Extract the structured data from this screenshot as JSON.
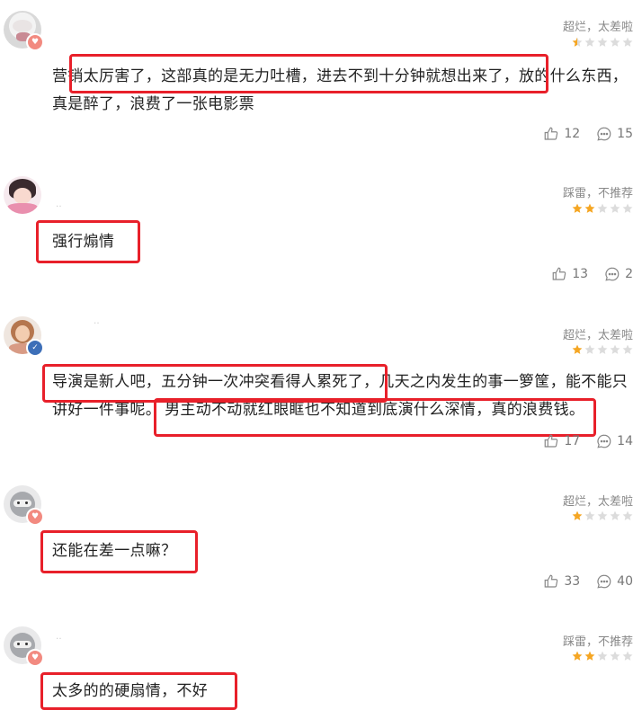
{
  "accent_red": "#e8202a",
  "star_color": "#f5a623",
  "comments": [
    {
      "rating_text": "超烂，太差啦",
      "stars": 0.5,
      "text": "营销太厉害了，这部真的是无力吐槽，进去不到十分钟就想出来了，放的什么东西，真是醉了，浪费了一张电影票",
      "likes": "12",
      "replies": "15"
    },
    {
      "rating_text": "踩雷，不推荐",
      "stars": 2,
      "text": "强行煽情",
      "likes": "13",
      "replies": "2"
    },
    {
      "rating_text": "超烂，太差啦",
      "stars": 1,
      "text_line1": "导演是新人吧，五分钟一次冲突看得人累死了，几天之内发生的事一箩筐，能不能只",
      "text_line2_a": "讲好一件事呢。",
      "text_line2_b": "男主动不动就红眼眶也不知道到底演什么深情，真的浪费钱。",
      "likes": "17",
      "replies": "14"
    },
    {
      "rating_text": "超烂，太差啦",
      "stars": 1,
      "text": "还能在差一点嘛？",
      "likes": "33",
      "replies": "40"
    },
    {
      "rating_text": "踩雷，不推荐",
      "stars": 2,
      "text": "太多的的硬扇情，不好"
    }
  ]
}
